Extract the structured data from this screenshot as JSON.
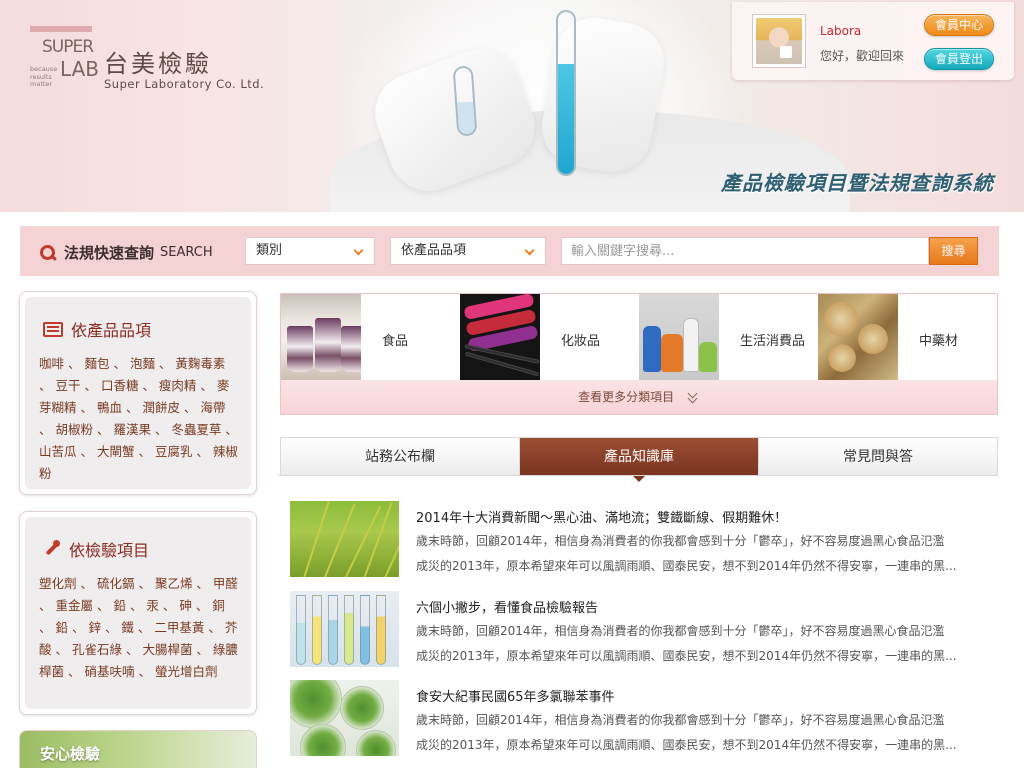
{
  "brand": {
    "mark_top": "SUPER",
    "mark_bottom": "LAB",
    "tagline": "because results matter",
    "name_zh": "台美檢驗",
    "name_en": "Super Laboratory Co. Ltd."
  },
  "system_title": "產品檢驗項目暨法規查詢系統",
  "member": {
    "name": "Labora",
    "greeting": "您好，歡迎回來",
    "center_label": "會員中心",
    "logout_label": "會員登出"
  },
  "search": {
    "label_zh": "法規快速查詢",
    "label_en": "SEARCH",
    "category_select": "類別",
    "product_select": "依產品品項",
    "placeholder": "輸入關鍵字搜尋...",
    "button": "搜尋"
  },
  "sidebar": {
    "products": {
      "heading": "依產品品項",
      "items": [
        "咖啡",
        "麵包",
        "泡麵",
        "黃麴毒素",
        "豆干",
        "口香糖",
        "瘦肉精",
        "麥芽糊精",
        "鴨血",
        "潤餅皮",
        "海帶",
        "胡椒粉",
        "羅漢果",
        "冬蟲夏草",
        "山苦瓜",
        "大閘蟹",
        "豆腐乳",
        "辣椒粉"
      ]
    },
    "tests": {
      "heading": "依檢驗項目",
      "items": [
        "塑化劑",
        "硫化鎘",
        "聚乙烯",
        "甲醛",
        "重金屬",
        "鉛",
        "汞",
        "砷",
        "銅",
        "鉛",
        "鋅",
        "鐵",
        "二甲基黃",
        "芥酸",
        "孔雀石綠",
        "大腸桿菌",
        "綠膿桿菌",
        "硝基呋喃",
        "螢光增白劑"
      ]
    },
    "peace_label": "安心檢驗"
  },
  "categories": {
    "items": [
      {
        "label": "食品",
        "icon": "food-photo"
      },
      {
        "label": "化妝品",
        "icon": "cosmetics-photo"
      },
      {
        "label": "生活消費品",
        "icon": "consumer-goods-photo"
      },
      {
        "label": "中藥材",
        "icon": "chinese-herbs-photo"
      }
    ],
    "more_label": "查看更多分類項目"
  },
  "tabs": [
    {
      "label": "站務公布欄",
      "active": false
    },
    {
      "label": "產品知識庫",
      "active": true
    },
    {
      "label": "常見問與答",
      "active": false
    }
  ],
  "news": [
    {
      "title": "2014年十大消費新聞～黑心油、滿地流；雙鐵斷線、假期難休！",
      "line1": "歲末時節，回顧2014年，相信身為消費者的你我都會感到十分「鬱卒」，好不容易度過黑心食品氾濫",
      "line2": "成災的2013年，原本希望來年可以風調雨順、國泰民安，想不到2014年仍然不得安寧，一連串的黑..."
    },
    {
      "title": "六個小撇步，看懂食品檢驗報告",
      "line1": "歲末時節，回顧2014年，相信身為消費者的你我都會感到十分「鬱卒」，好不容易度過黑心食品氾濫",
      "line2": "成災的2013年，原本希望來年可以風調雨順、國泰民安，想不到2014年仍然不得安寧，一連串的黑..."
    },
    {
      "title": "食安大紀事民國65年多氯聯苯事件",
      "line1": "歲末時節，回顧2014年，相信身為消費者的你我都會感到十分「鬱卒」，好不容易度過黑心食品氾濫",
      "line2": "成災的2013年，原本希望來年可以風調雨順、國泰民安，想不到2014年仍然不得安寧，一連串的黑..."
    }
  ],
  "colors": {
    "accent_orange": "#ee8a19",
    "accent_teal": "#14a9bb",
    "active_tab": "#7a3420",
    "title_blue": "#2f5f72",
    "search_bar_bg": "#f5d3d5",
    "sidebar_link": "#7a3a22"
  }
}
